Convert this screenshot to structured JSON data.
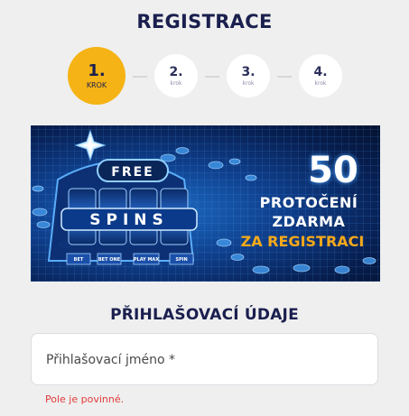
{
  "header": {
    "title": "REGISTRACE"
  },
  "steps": [
    {
      "number": "1.",
      "label": "KROK",
      "active": true
    },
    {
      "number": "2.",
      "label": "krok",
      "active": false
    },
    {
      "number": "3.",
      "label": "krok",
      "active": false
    },
    {
      "number": "4.",
      "label": "krok",
      "active": false
    }
  ],
  "banner": {
    "logo_text_free": "FREE",
    "logo_text_spins": "SPINS",
    "button_labels": [
      "BET",
      "BET ONE",
      "PLAY MAX",
      "SPIN"
    ],
    "count": "50",
    "line1": "PROTOČENÍ",
    "line2": "ZDARMA",
    "line3": "ZA REGISTRACI",
    "colors": {
      "accent": "#f5a91a",
      "background": "#0f3f8c"
    }
  },
  "section": {
    "title": "PŘIHLAŠOVACÍ ÚDAJE"
  },
  "form": {
    "username_placeholder": "Přihlašovací jméno *",
    "username_value": "",
    "error": "Pole je povinné."
  },
  "colors": {
    "primary": "#1a1f4e",
    "step_active": "#f5b315",
    "error": "#e23b3b"
  }
}
